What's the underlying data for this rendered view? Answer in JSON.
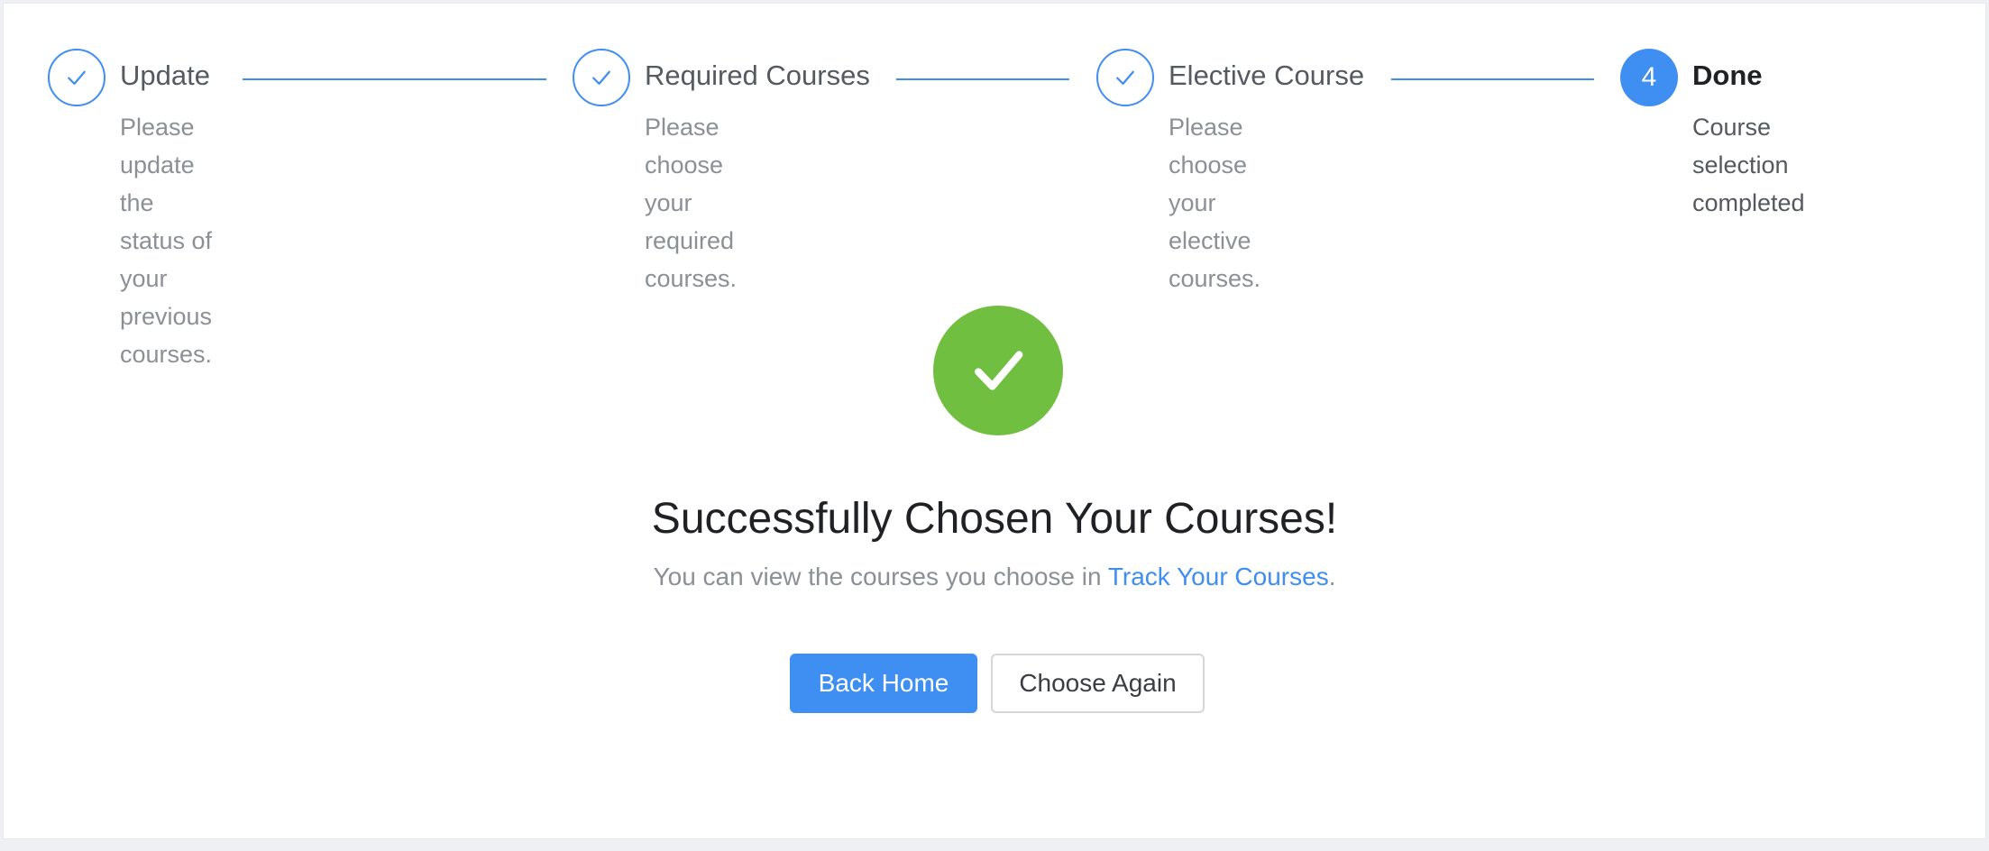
{
  "steps": [
    {
      "title": "Update",
      "desc_lines": [
        "Please update the",
        "status of your previous",
        "courses."
      ],
      "state": "finished"
    },
    {
      "title": "Required Courses",
      "desc_lines": [
        "Please choose your",
        "required courses."
      ],
      "state": "finished"
    },
    {
      "title": "Elective Course",
      "desc_lines": [
        "Please choose your",
        "elective courses."
      ],
      "state": "finished"
    },
    {
      "title": "Done",
      "number": "4",
      "desc_lines": [
        "Course selection",
        "completed"
      ],
      "state": "current"
    }
  ],
  "result": {
    "icon": "check-circle-icon",
    "title": "Successfully Chosen Your Courses!",
    "subtitle_prefix": "You can view the courses you choose in ",
    "subtitle_link": "Track Your Courses",
    "subtitle_suffix": "."
  },
  "buttons": {
    "primary_label": "Back Home",
    "secondary_label": "Choose Again"
  },
  "colors": {
    "accent": "#3f8ef2",
    "success": "#70bf41"
  }
}
